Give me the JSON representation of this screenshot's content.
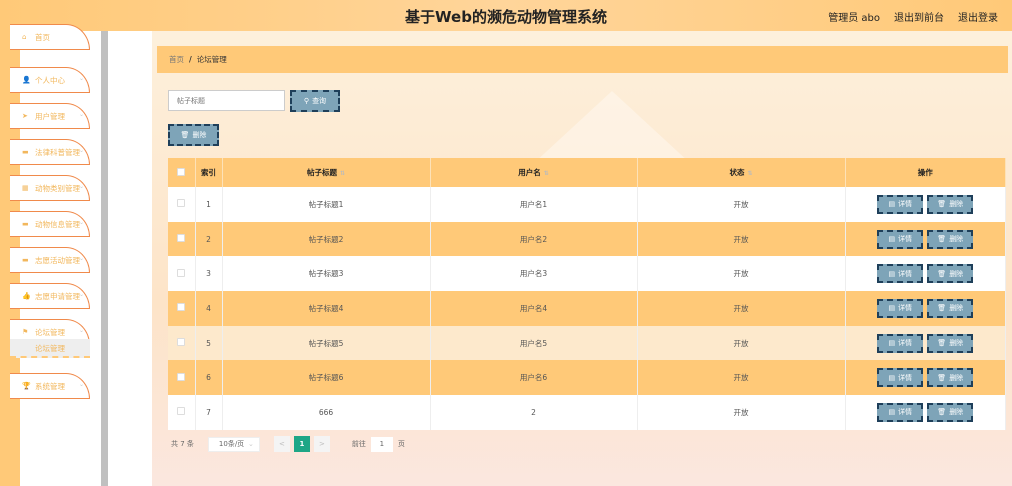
{
  "header": {
    "title": "基于Web的濒危动物管理系统",
    "user": "管理员 abo",
    "to_front": "退出到前台",
    "logout": "退出登录"
  },
  "sidebar": {
    "items": [
      {
        "label": "首页",
        "icon": "home-icon"
      },
      {
        "label": "个人中心",
        "icon": "user-icon"
      },
      {
        "label": "用户管理",
        "icon": "send-icon"
      },
      {
        "label": "法律科普管理",
        "icon": "book-icon"
      },
      {
        "label": "动物类别管理",
        "icon": "grid-icon"
      },
      {
        "label": "动物信息管理",
        "icon": "message-icon"
      },
      {
        "label": "志愿活动管理",
        "icon": "ticket-icon"
      },
      {
        "label": "志愿申请管理",
        "icon": "thumb-icon"
      },
      {
        "label": "论坛管理",
        "icon": "flag-icon"
      },
      {
        "label": "系统管理",
        "icon": "trophy-icon"
      }
    ],
    "sub_item": "论坛管理"
  },
  "breadcrumb": {
    "home": "首页",
    "sep": "/",
    "current": "论坛管理"
  },
  "search": {
    "placeholder": "帖子标题",
    "button": "查询"
  },
  "toolbar": {
    "delete": "删除"
  },
  "table": {
    "headers": [
      "索引",
      "帖子标题",
      "用户名",
      "状态",
      "操作"
    ],
    "rows": [
      [
        "1",
        "帖子标题1",
        "用户名1",
        "开放"
      ],
      [
        "2",
        "帖子标题2",
        "用户名2",
        "开放"
      ],
      [
        "3",
        "帖子标题3",
        "用户名3",
        "开放"
      ],
      [
        "4",
        "帖子标题4",
        "用户名4",
        "开放"
      ],
      [
        "5",
        "帖子标题5",
        "用户名5",
        "开放"
      ],
      [
        "6",
        "帖子标题6",
        "用户名6",
        "开放"
      ],
      [
        "7",
        "666",
        "2",
        "开放"
      ]
    ],
    "detail": "详情",
    "delete": "删除"
  },
  "pager": {
    "total": "共 7 条",
    "size": "10条/页",
    "prev": "<",
    "current": "1",
    "next": ">",
    "goto": "前往",
    "goto_value": "1",
    "page_unit": "页"
  }
}
